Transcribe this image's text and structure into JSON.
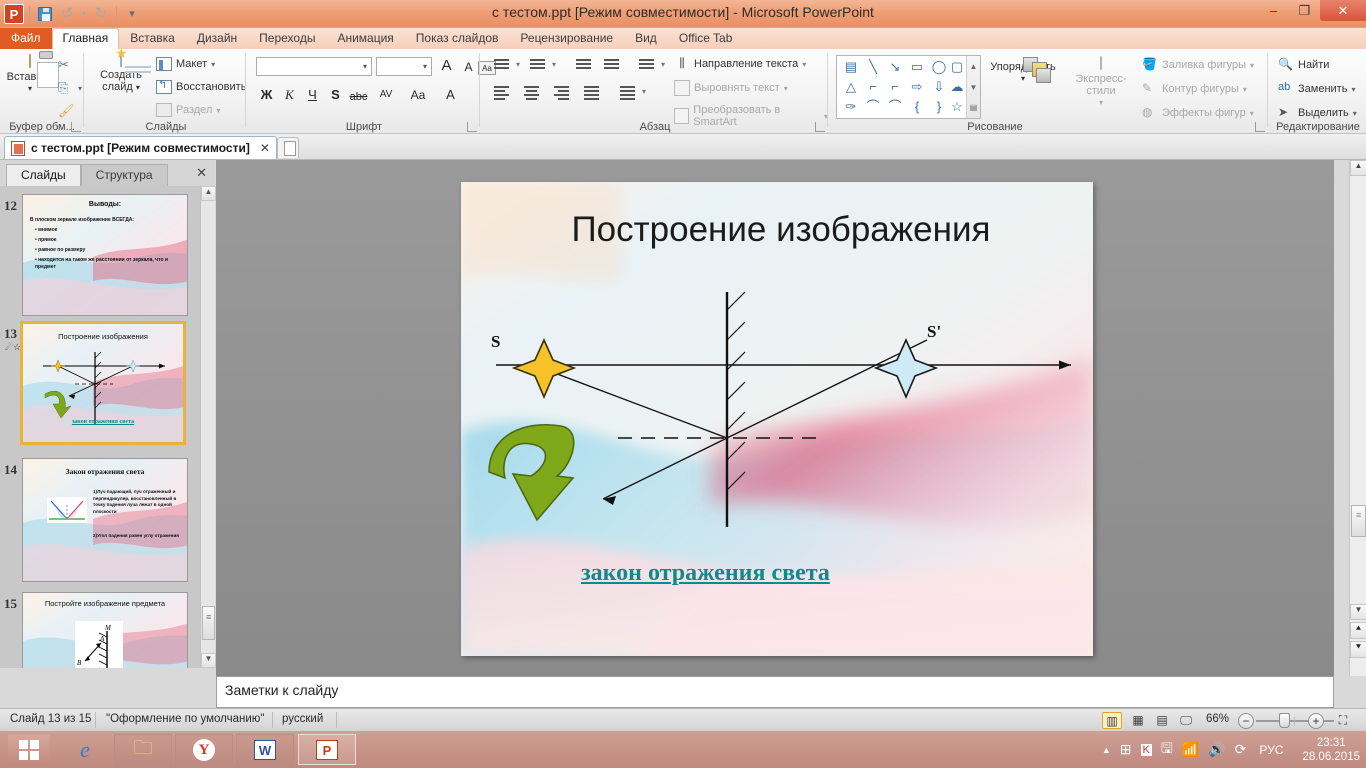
{
  "window": {
    "title": "с тестом.ppt [Режим совместимости]  -  Microsoft PowerPoint",
    "minimize": "–",
    "restore": "❐",
    "close": "✕",
    "help": "?",
    "collapse_ribbon": "︿"
  },
  "qat": {
    "logo": "P",
    "save": "save-icon",
    "undo": "↺",
    "undo_caret": "▾",
    "redo": "↻",
    "customize": "▾"
  },
  "tabs": [
    {
      "label": "Файл",
      "state": "file"
    },
    {
      "label": "Главная",
      "state": "active"
    },
    {
      "label": "Вставка",
      "state": "normal"
    },
    {
      "label": "Дизайн",
      "state": "normal"
    },
    {
      "label": "Переходы",
      "state": "normal"
    },
    {
      "label": "Анимация",
      "state": "normal"
    },
    {
      "label": "Показ слайдов",
      "state": "normal"
    },
    {
      "label": "Рецензирование",
      "state": "normal"
    },
    {
      "label": "Вид",
      "state": "normal"
    },
    {
      "label": "Office Tab",
      "state": "normal"
    }
  ],
  "ribbon": {
    "clipboard": {
      "group_label": "Буфер обм...",
      "paste_label": "Вставить",
      "paste_caret": "▾",
      "cut": "✂",
      "copy": "⎘",
      "copy_caret": "▾",
      "format_painter": "🖌"
    },
    "slides": {
      "group_label": "Слайды",
      "new_slide_line1": "Создать",
      "new_slide_line2": "слайд",
      "new_slide_caret": "▾",
      "layout": "Макет",
      "layout_caret": "▾",
      "reset": "Восстановить",
      "section": "Раздел",
      "section_caret": "▾"
    },
    "font": {
      "group_label": "Шрифт",
      "font_name_value": "",
      "font_size_value": "",
      "grow_font": "A",
      "shrink_font": "A",
      "clear_formatting": "Aa",
      "bold": "Ж",
      "italic": "К",
      "underline": "Ч",
      "shadow": "S",
      "strike": "abc",
      "spacing": "AV",
      "change_case": "Aa",
      "font_color": "A"
    },
    "paragraph": {
      "group_label": "Абзац",
      "text_direction": "Направление текста",
      "align_text": "Выровнять текст",
      "convert_smartart": "Преобразовать в SmartArt"
    },
    "drawing": {
      "group_label": "Рисование",
      "arrange": "Упорядочить",
      "arrange_caret": "▾",
      "quick_styles": "Экспресс-стили",
      "quick_styles_caret": "▾",
      "shape_fill": "Заливка фигуры",
      "shape_outline": "Контур фигуры",
      "shape_effects": "Эффекты фигур",
      "caret": "▾"
    },
    "editing": {
      "group_label": "Редактирование",
      "find": "Найти",
      "replace": "Заменить",
      "select": "Выделить",
      "caret": "▾"
    }
  },
  "doctab": {
    "label": "с тестом.ppt [Режим совместимости]",
    "close": "✕",
    "new_tab": "new-document-icon"
  },
  "left_pane": {
    "tabs": [
      {
        "label": "Слайды",
        "active": true
      },
      {
        "label": "Структура",
        "active": false
      }
    ],
    "close": "✕",
    "thumbnails": [
      {
        "number": "12",
        "title": "Выводы:",
        "intro": "В плоском зеркале изображение ВСЕГДА:",
        "bullets": [
          "мнимое",
          "прямое",
          "равное по размеру",
          "находится на таком же расстоянии от зеркала, что и предмет"
        ],
        "selected": false
      },
      {
        "number": "13",
        "title": "Построение изображения",
        "link": "закон отражения света",
        "selected": true,
        "has_animation_icon": true
      },
      {
        "number": "14",
        "title": "Закон отражения света",
        "body": [
          "1)Луч падающий, луч отраженный и перпендикуляр, восстановленный в точку падения луча лежат в одной плоскости",
          "2)Угол падения равен углу отражения"
        ],
        "selected": false
      },
      {
        "number": "15",
        "title": "Постройте изображение предмета",
        "selected": false
      }
    ]
  },
  "slide": {
    "title": "Построение изображения",
    "link": "закон отражения света",
    "label_source": "S",
    "label_image": "S'"
  },
  "notes": {
    "placeholder": "Заметки к слайду"
  },
  "status_bar": {
    "slide_counter": "Слайд 13 из 15",
    "theme": "\"Оформление по умолчанию\"",
    "language": "русский",
    "zoom_value": "66%",
    "zoom_out": "−",
    "zoom_in": "+",
    "views": [
      "normal-view",
      "slide-sorter-view",
      "reading-view",
      "slideshow-view"
    ],
    "fit_to_window": "fit-slide-icon"
  },
  "taskbar": {
    "start": "windows-start-icon",
    "items": [
      {
        "name": "internet-explorer",
        "glyph": "e"
      },
      {
        "name": "file-explorer",
        "glyph": "🗀"
      },
      {
        "name": "yandex-browser",
        "glyph": "Y"
      },
      {
        "name": "microsoft-word",
        "glyph": "W"
      },
      {
        "name": "microsoft-powerpoint",
        "glyph": "P"
      }
    ],
    "tray": [
      "show-hidden-icons",
      "windows-icon",
      "kaspersky-icon",
      "usb-icon",
      "network-icon",
      "volume-icon",
      "update-icon"
    ],
    "language": "РУС",
    "time": "23:31",
    "date": "28.06.2015"
  },
  "colors": {
    "accent": "#e05c22",
    "titlebar": "#ef9f77",
    "link": "#0e8a8a",
    "selection": "#e8b33a",
    "taskbar": "#c79489"
  }
}
